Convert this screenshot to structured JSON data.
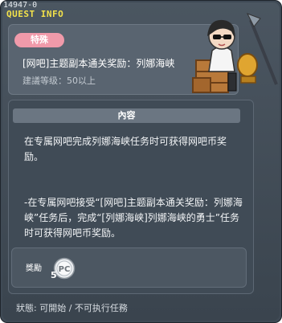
{
  "window": {
    "id_text": "14947-0",
    "title": "QUEST INFO"
  },
  "quest": {
    "badge": "特殊",
    "name": "[网吧]主题副本通关奖励：列娜海峡",
    "level": "建議等级：50以上"
  },
  "content": {
    "header": "內容",
    "description_1": "在专属网吧完成列娜海峡任务时可获得网吧币奖励。",
    "description_2": "-在专属网吧接受“[网吧]主题副本通关奖励：列娜海峡”任务后，完成“[列娜海峡]列娜海峡的勇士”任务时可获得网吧币奖励。"
  },
  "reward": {
    "label": "獎勵",
    "icon": "pc-coin-icon",
    "icon_text": "PC",
    "quantity": "5"
  },
  "status": {
    "text": "狀態: 可開始 / 不可执行任務"
  },
  "colors": {
    "title": "#f3e24a",
    "badge": "#f09aaa",
    "window_bg": "#3f4a55"
  }
}
